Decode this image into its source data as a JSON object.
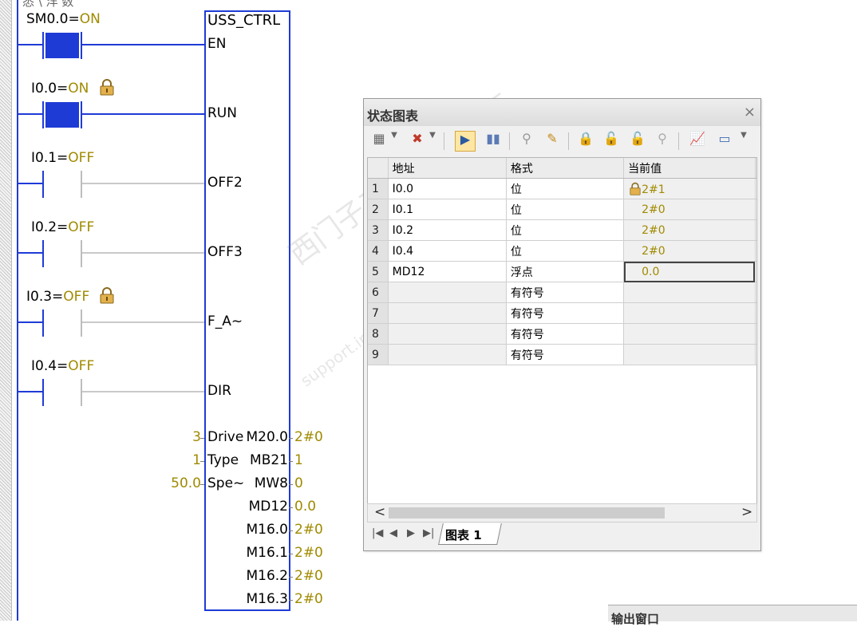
{
  "ladder": {
    "top_partial": "悉 \\ 洋 数",
    "contacts": [
      {
        "label": "SM0.0=",
        "state": "ON",
        "locked": false,
        "on": true
      },
      {
        "label": "I0.0=",
        "state": "ON",
        "locked": true,
        "on": true
      },
      {
        "label": "I0.1=",
        "state": "OFF",
        "locked": false,
        "on": false
      },
      {
        "label": "I0.2=",
        "state": "OFF",
        "locked": false,
        "on": false
      },
      {
        "label": "I0.3=",
        "state": "OFF",
        "locked": true,
        "on": false
      },
      {
        "label": "I0.4=",
        "state": "OFF",
        "locked": false,
        "on": false
      }
    ],
    "block": {
      "title": "USS_CTRL",
      "inputs": [
        "EN",
        "RUN",
        "OFF2",
        "OFF3",
        "F_A~",
        "DIR"
      ],
      "params": [
        {
          "in_value": "3",
          "in_pin": "Drive",
          "out_pin": "M20.0",
          "out_value": "2#0"
        },
        {
          "in_value": "1",
          "in_pin": "Type",
          "out_pin": "MB21",
          "out_value": "1"
        },
        {
          "in_value": "50.0",
          "in_pin": "Spe~",
          "out_pin": "MW8",
          "out_value": "0"
        },
        {
          "in_value": "",
          "in_pin": "",
          "out_pin": "MD12",
          "out_value": "0.0"
        },
        {
          "in_value": "",
          "in_pin": "",
          "out_pin": "M16.0",
          "out_value": "2#0"
        },
        {
          "in_value": "",
          "in_pin": "",
          "out_pin": "M16.1",
          "out_value": "2#0"
        },
        {
          "in_value": "",
          "in_pin": "",
          "out_pin": "M16.2",
          "out_value": "2#0"
        },
        {
          "in_value": "",
          "in_pin": "",
          "out_pin": "M16.3",
          "out_value": "2#0"
        }
      ]
    },
    "colors": {
      "rail": "#1f3bd6",
      "value": "#a08a00"
    }
  },
  "status_chart": {
    "title": "状态图表",
    "close_icon": "×",
    "columns": [
      "地址",
      "格式",
      "当前值"
    ],
    "rows": [
      {
        "n": "1",
        "address": "I0.0",
        "format": "位",
        "value": "2#1",
        "locked": true
      },
      {
        "n": "2",
        "address": "I0.1",
        "format": "位",
        "value": "2#0",
        "locked": false
      },
      {
        "n": "3",
        "address": "I0.2",
        "format": "位",
        "value": "2#0",
        "locked": false
      },
      {
        "n": "4",
        "address": "I0.4",
        "format": "位",
        "value": "2#0",
        "locked": false
      },
      {
        "n": "5",
        "address": "MD12",
        "format": "浮点",
        "value": "0.0",
        "locked": false
      },
      {
        "n": "6",
        "address": "",
        "format": "有符号",
        "value": "",
        "locked": false
      },
      {
        "n": "7",
        "address": "",
        "format": "有符号",
        "value": "",
        "locked": false
      },
      {
        "n": "8",
        "address": "",
        "format": "有符号",
        "value": "",
        "locked": false
      },
      {
        "n": "9",
        "address": "",
        "format": "有符号",
        "value": "",
        "locked": false
      }
    ],
    "tab": "图表 1",
    "nav_icons": [
      "first-icon",
      "prev-icon",
      "next-icon",
      "last-icon"
    ],
    "toolbar_icons": [
      "insert-row-icon",
      "delete-row-icon",
      "chart-monitor-icon",
      "pause-icon",
      "read-icon",
      "write-icon",
      "force-icon",
      "unforce-icon",
      "unforce-all-icon",
      "read-forced-icon",
      "trend-view-icon",
      "tag-icon"
    ]
  },
  "watermark": {
    "line1": "西门子工业 技术论坛",
    "line2": "support.industry.siemens.com/cs"
  },
  "output_window": {
    "title": "输出窗口"
  }
}
